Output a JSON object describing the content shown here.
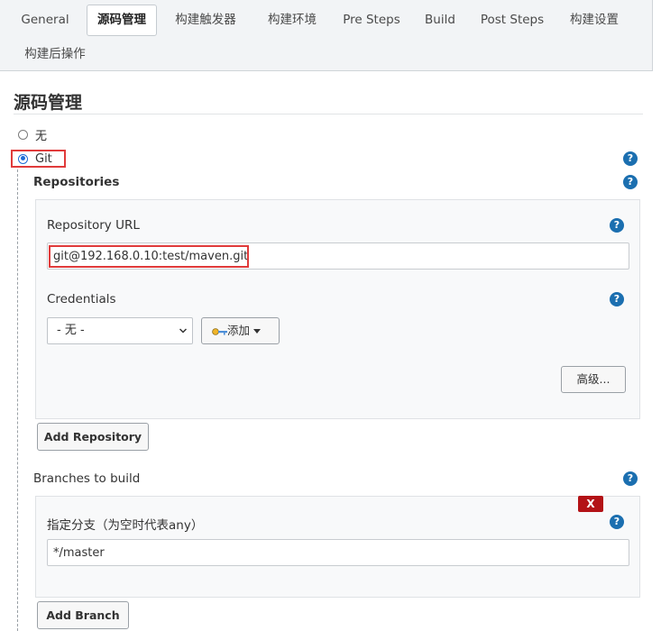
{
  "tabs": [
    {
      "label": "General",
      "active": false
    },
    {
      "label": "源码管理",
      "active": true
    },
    {
      "label": "构建触发器",
      "active": false
    },
    {
      "label": "构建环境",
      "active": false
    },
    {
      "label": "Pre Steps",
      "active": false
    },
    {
      "label": "Build",
      "active": false
    },
    {
      "label": "Post Steps",
      "active": false
    },
    {
      "label": "构建设置",
      "active": false
    },
    {
      "label": "构建后操作",
      "active": false
    }
  ],
  "section": {
    "title": "源码管理"
  },
  "scm_options": [
    {
      "label": "无",
      "selected": false
    },
    {
      "label": "Git",
      "selected": true
    }
  ],
  "help": {
    "glyph": "?"
  },
  "repositories": {
    "label": "Repositories",
    "url_label": "Repository URL",
    "url_value": "git@192.168.0.10:test/maven.git",
    "credentials_label": "Credentials",
    "credentials_selected": "- 无 -",
    "add_label": "添加",
    "advanced_label": "高级...",
    "add_repository_label": "Add Repository"
  },
  "branches": {
    "label": "Branches to build",
    "delete_label": "X",
    "specifier_label": "指定分支（为空时代表any）",
    "specifier_value": "*/master",
    "add_branch_label": "Add Branch"
  },
  "colors": {
    "accent": "#1e6bd6",
    "help": "#1b6fb0",
    "highlight": "#e03b3b",
    "delete": "#b31216"
  }
}
